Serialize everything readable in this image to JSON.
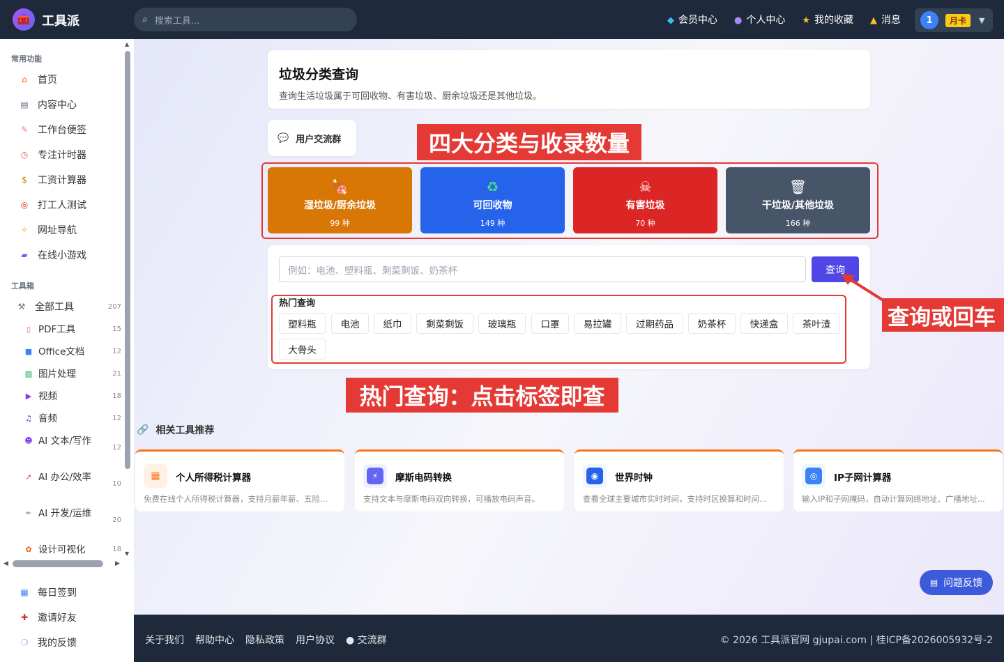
{
  "header": {
    "brand": "工具派",
    "search_placeholder": "搜索工具...",
    "links": [
      {
        "icon": "diamond-icon",
        "label": "会员中心"
      },
      {
        "icon": "user-icon",
        "label": "个人中心"
      },
      {
        "icon": "star-icon",
        "label": "我的收藏"
      },
      {
        "icon": "bell-icon",
        "label": "消息"
      }
    ],
    "avatar_text": "1",
    "plan": "月卡"
  },
  "sidebar": {
    "section_common": "常用功能",
    "common": [
      {
        "icon": "home-icon",
        "label": "首页"
      },
      {
        "icon": "newspaper-icon",
        "label": "内容中心"
      },
      {
        "icon": "memo-icon",
        "label": "工作台便签"
      },
      {
        "icon": "timer-icon",
        "label": "专注计时器"
      },
      {
        "icon": "money-bag-icon",
        "label": "工资计算器"
      },
      {
        "icon": "target-icon",
        "label": "打工人测试"
      },
      {
        "icon": "compass-icon",
        "label": "网址导航"
      },
      {
        "icon": "gamepad-icon",
        "label": "在线小游戏"
      }
    ],
    "section_tools": "工具箱",
    "all_tools": {
      "label": "全部工具",
      "count": "207"
    },
    "categories": [
      {
        "label": "PDF工具",
        "count": "15"
      },
      {
        "label": "Office文档",
        "count": "12"
      },
      {
        "label": "图片处理",
        "count": "21"
      },
      {
        "label": "视频",
        "count": "18"
      },
      {
        "label": "音频",
        "count": "12"
      },
      {
        "label": "AI 文本/写作",
        "count": "12"
      },
      {
        "label": "AI 办公/效率",
        "count": "10"
      },
      {
        "label": "AI 开发/运维",
        "count": "20"
      },
      {
        "label": "设计可视化",
        "count": "18"
      }
    ],
    "bottom": [
      {
        "icon": "calendar-icon",
        "label": "每日签到"
      },
      {
        "icon": "gift-icon",
        "label": "邀请好友"
      },
      {
        "icon": "speech-icon",
        "label": "我的反馈"
      }
    ]
  },
  "page": {
    "title": "垃圾分类查询",
    "subtitle": "查询生活垃圾属于可回收物、有害垃圾、厨余垃圾还是其他垃圾。",
    "group_label": "用户交流群"
  },
  "categories": [
    {
      "name": "湿垃圾/厨余垃圾",
      "count": "99 种",
      "color": "#d97706",
      "icon": "🍖"
    },
    {
      "name": "可回收物",
      "count": "149 种",
      "color": "#2563eb",
      "icon": "♻"
    },
    {
      "name": "有害垃圾",
      "count": "70 种",
      "color": "#dc2626",
      "icon": "☠"
    },
    {
      "name": "干垃圾/其他垃圾",
      "count": "166 种",
      "color": "#475569",
      "icon": "🗑"
    }
  ],
  "query": {
    "placeholder": "例如：电池、塑料瓶、剩菜剩饭、奶茶杯",
    "button": "查询",
    "hot_label": "热门查询",
    "tags": [
      "塑料瓶",
      "电池",
      "纸巾",
      "剩菜剩饭",
      "玻璃瓶",
      "口罩",
      "易拉罐",
      "过期药品",
      "奶茶杯",
      "快递盒",
      "茶叶渣",
      "大骨头"
    ]
  },
  "annotations": {
    "categories": "四大分类与收录数量",
    "query": "查询或回车",
    "hot": "热门查询：点击标签即查"
  },
  "related": {
    "title": "相关工具推荐",
    "items": [
      {
        "name": "个人所得税计算器",
        "desc": "免费在线个人所得税计算器，支持月薪年薪、五险...",
        "icon": "calculator-icon",
        "glyph": "▦",
        "color": "#f97316",
        "bg": "#fff1e6"
      },
      {
        "name": "摩斯电码转换",
        "desc": "支持文本与摩斯电码双向转换，可播放电码声音。",
        "icon": "bolt-icon",
        "glyph": "⚡",
        "color": "#fff",
        "bg": "#6366f1"
      },
      {
        "name": "世界时钟",
        "desc": "查看全球主要城市实时时间，支持时区换算和时间...",
        "icon": "globe-icon",
        "glyph": "◉",
        "color": "#fff",
        "bg": "#2563eb"
      },
      {
        "name": "IP子网计算器",
        "desc": "输入IP和子网掩码，自动计算网络地址、广播地址...",
        "icon": "network-icon",
        "glyph": "◎",
        "color": "#fff",
        "bg": "#3b82f6"
      }
    ]
  },
  "feedback": "问题反馈",
  "footer": {
    "links": [
      "关于我们",
      "帮助中心",
      "隐私政策",
      "用户协议",
      "交流群"
    ],
    "copyright": "© 2026 工具派官网 gjupai.com | 桂ICP备2026005932号-2"
  }
}
